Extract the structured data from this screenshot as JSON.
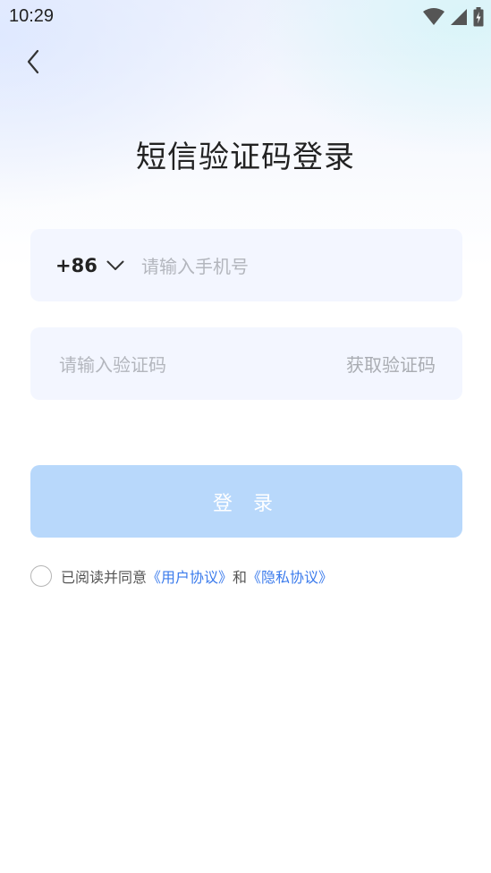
{
  "status_bar": {
    "time": "10:29"
  },
  "header": {
    "title": "短信验证码登录"
  },
  "phone_field": {
    "country_code": "+86",
    "placeholder": "请输入手机号"
  },
  "code_field": {
    "placeholder": "请输入验证码",
    "get_code_label": "获取验证码"
  },
  "login_button": {
    "label": "登 录"
  },
  "agreement": {
    "prefix": "已阅读并同意",
    "user_agreement": "《用户协议》",
    "conjunction": "和",
    "privacy_policy": "《隐私协议》",
    "checked": false
  },
  "colors": {
    "accent_link": "#3b7bec",
    "button_disabled": "#b8d8fb",
    "field_background": "#f3f6ff"
  }
}
